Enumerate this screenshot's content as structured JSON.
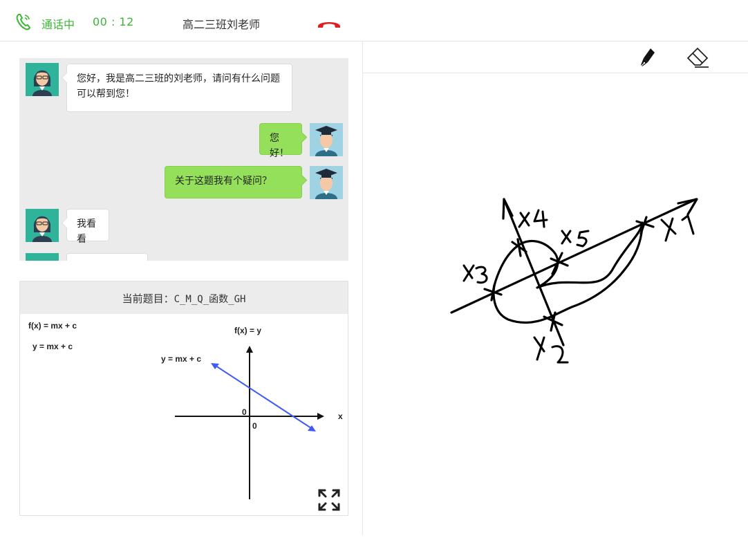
{
  "call": {
    "status": "通话中",
    "timer": "00 : 12",
    "contact": "高二三班刘老师",
    "icons": {
      "phone": "phone-call-icon",
      "hangup": "hang-up-icon"
    },
    "accent_color": "#3db536",
    "hangup_color": "#e02020"
  },
  "chat": {
    "messages": [
      {
        "from": "teacher",
        "text": "您好，我是高二三班的刘老师，请问有什么问题可以帮到您！"
      },
      {
        "from": "student",
        "text": "您好！"
      },
      {
        "from": "student",
        "text": "关于这题我有个疑问？"
      },
      {
        "from": "teacher",
        "text": "我看看"
      }
    ]
  },
  "question": {
    "label": "当前题目：",
    "code": "C_M_Q_函数_GH",
    "figure": {
      "eq1": "f(x) = mx + c",
      "eq2": "y = mx + c",
      "axis_label": "f(x) = y",
      "line_label": "y = mx + c",
      "x_label": "x",
      "origin_a": "0",
      "origin_b": "0",
      "line_color": "#3f5bf5"
    },
    "expand_icon": "expand-icon"
  },
  "whiteboard": {
    "tools": [
      "pen-icon",
      "eraser-icon"
    ],
    "labels": [
      "X1",
      "X2",
      "X3",
      "X4",
      "X5"
    ]
  }
}
